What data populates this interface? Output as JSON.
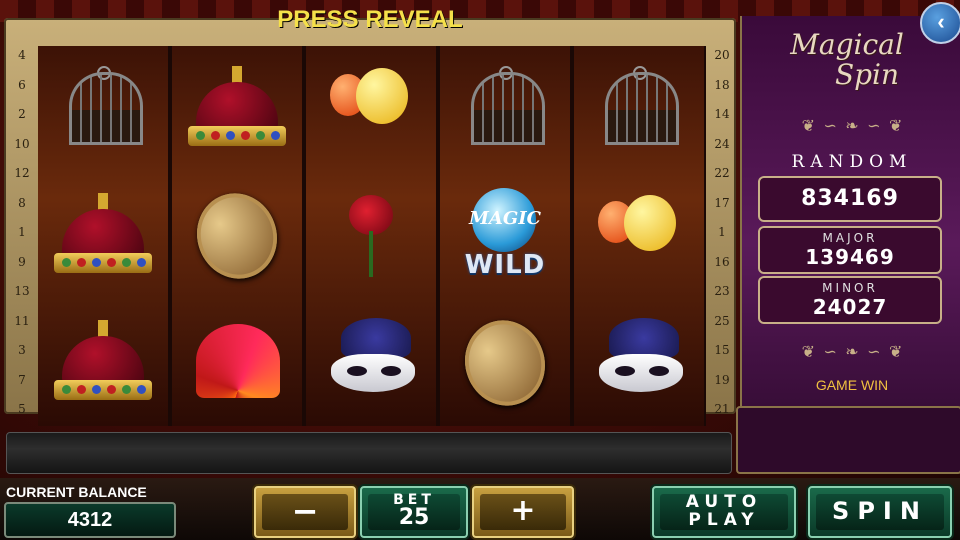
{
  "game": {
    "logo_line1": "Magical",
    "logo_line2": "Spin",
    "back_icon": "back-arrow-icon"
  },
  "paylines": {
    "left": [
      "4",
      "6",
      "2",
      "10",
      "12",
      "8",
      "1",
      "9",
      "13",
      "11",
      "3",
      "7",
      "5"
    ],
    "right": [
      "20",
      "18",
      "14",
      "24",
      "22",
      "17",
      "1",
      "16",
      "23",
      "25",
      "15",
      "19",
      "21"
    ]
  },
  "reels": [
    [
      "birdcage",
      "crown",
      "crown"
    ],
    [
      "crown",
      "gold-coin",
      "feather-fan"
    ],
    [
      "balloons",
      "rose",
      "masquerade-mask"
    ],
    [
      "birdcage",
      "magic-wild",
      "gold-coin"
    ],
    [
      "birdcage",
      "balloons",
      "masquerade-mask"
    ]
  ],
  "wild": {
    "orb_text": "MAGIC",
    "label": "WILD"
  },
  "jackpots": {
    "title": "RANDOM",
    "random_value": "834169",
    "major_label": "MAJOR",
    "major_value": "139469",
    "minor_label": "MINOR",
    "minor_value": "24027"
  },
  "game_win": {
    "label": "GAME WIN",
    "value": ""
  },
  "message": "PRESS REVEAL",
  "balance": {
    "label": "CURRENT BALANCE",
    "value": "4312"
  },
  "controls": {
    "minus_label": "−",
    "bet_label": "BET",
    "bet_value": "25",
    "plus_label": "+",
    "autoplay_line1": "AUTO",
    "autoplay_line2": "PLAY",
    "spin_label": "SPIN"
  },
  "colors": {
    "message_text": "#f5e04a",
    "game_win_text": "#f0c040",
    "panel_bg": "#3a0a3a"
  }
}
